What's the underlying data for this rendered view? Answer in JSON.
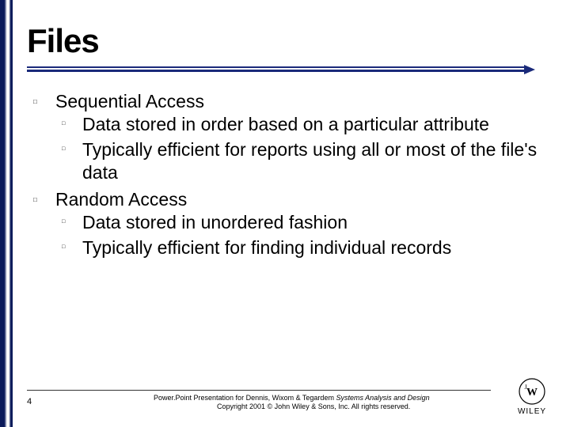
{
  "title": "Files",
  "bullets": [
    {
      "head": "Sequential Access",
      "subs": [
        "Data stored in order based on a particular attribute",
        "Typically efficient for reports using all or most of the file's data"
      ]
    },
    {
      "head": "Random Access",
      "subs": [
        "Data stored in unordered fashion",
        "Typically efficient for finding individual records"
      ]
    }
  ],
  "footer": {
    "page": "4",
    "line1_plain": "Power.Point Presentation for Dennis, Wixom & Tegardem ",
    "line1_italic": "Systems Analysis and Design",
    "line2": "Copyright 2001 © John Wiley & Sons, Inc.  All rights reserved."
  },
  "logo_text": "WILEY"
}
